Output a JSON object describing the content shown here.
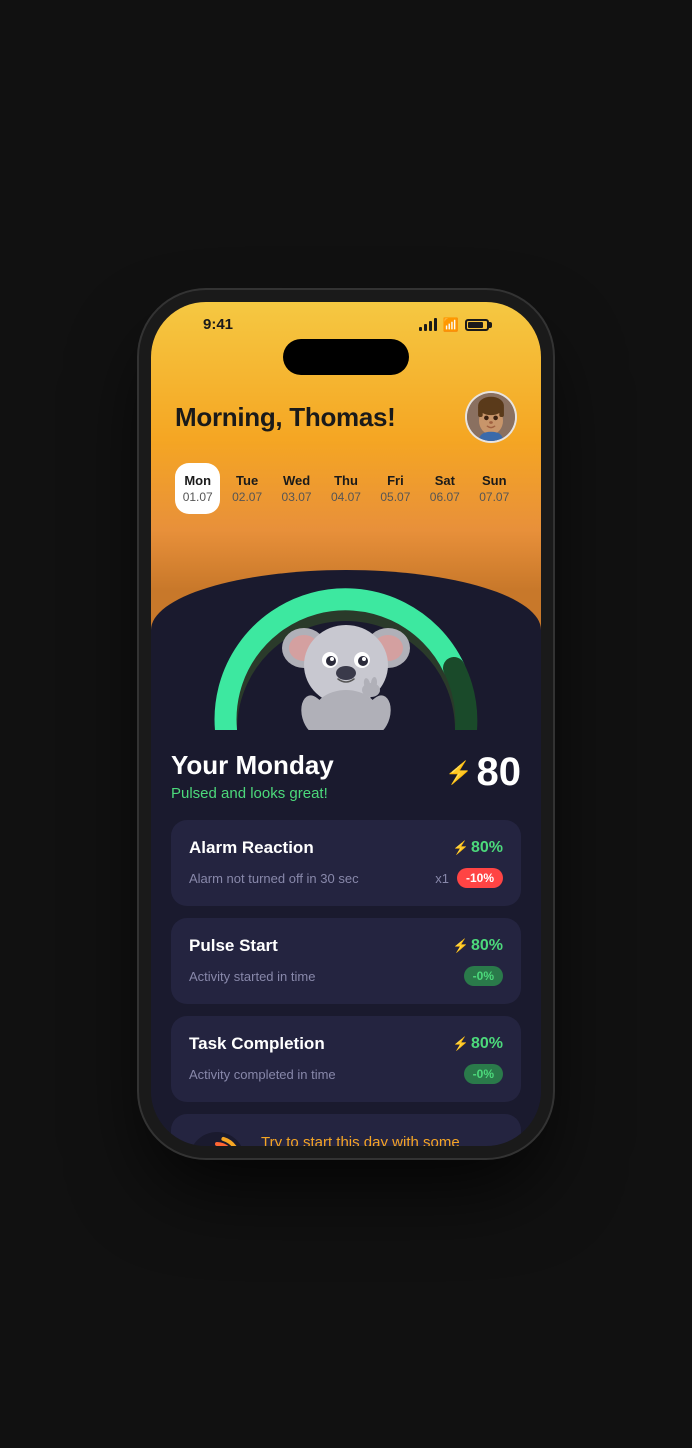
{
  "status": {
    "time": "9:41",
    "signal": [
      2,
      3,
      4,
      5
    ],
    "battery": 85
  },
  "header": {
    "greeting": "Morning, Thomas!"
  },
  "calendar": {
    "days": [
      {
        "name": "Mon",
        "date": "01.07",
        "active": true
      },
      {
        "name": "Tue",
        "date": "02.07",
        "active": false
      },
      {
        "name": "Wed",
        "date": "03.07",
        "active": false
      },
      {
        "name": "Thu",
        "date": "04.07",
        "active": false
      },
      {
        "name": "Fri",
        "date": "05.07",
        "active": false
      },
      {
        "name": "Sat",
        "date": "06.07",
        "active": false
      },
      {
        "name": "Sun",
        "date": "07.07",
        "active": false
      }
    ]
  },
  "dayScore": {
    "title": "Your Monday",
    "subtitle": "Pulsed and looks great!",
    "score": "80"
  },
  "metrics": [
    {
      "title": "Alarm Reaction",
      "score": "80%",
      "desc": "Alarm not turned off in 30 sec",
      "count": "x1",
      "badge": "-10%",
      "badgeType": "red"
    },
    {
      "title": "Pulse Start",
      "score": "80%",
      "desc": "Activity started in time",
      "count": "",
      "badge": "-0%",
      "badgeType": "green"
    },
    {
      "title": "Task Completion",
      "score": "80%",
      "desc": "Activity completed in time",
      "count": "",
      "badge": "-0%",
      "badgeType": "green"
    }
  ],
  "tip": {
    "text": "Try to start this day with some positive affirmations. It's amazing how a little positivity can set the tone for your day."
  },
  "colors": {
    "accent_green": "#4cd97b",
    "accent_orange": "#f5a623",
    "accent_red": "#ff4444",
    "dark_bg": "#1a1a2e",
    "card_bg": "#242440"
  }
}
